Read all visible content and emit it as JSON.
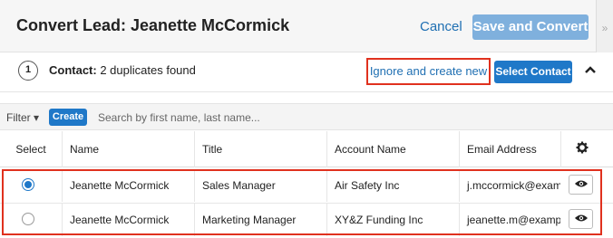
{
  "header": {
    "title": "Convert Lead: Jeanette McCormick",
    "cancel_label": "Cancel",
    "save_label": "Save and Convert",
    "toggle_glyph": "»"
  },
  "step": {
    "number": "1",
    "module": "Contact:",
    "status": "2 duplicates found",
    "ignore_label": "Ignore and create new",
    "select_label": "Select Contact",
    "collapse_icon": "chevron-up-icon"
  },
  "filter": {
    "filter_label": "Filter ▾",
    "create_label": "Create",
    "search_placeholder": "Search by first name, last name..."
  },
  "table": {
    "columns": [
      "Select",
      "Name",
      "Title",
      "Account Name",
      "Email Address"
    ],
    "rows": [
      {
        "selected": true,
        "name": "Jeanette McCormick",
        "title": "Sales Manager",
        "account": "Air Safety Inc",
        "email": "j.mccormick@example.com"
      },
      {
        "selected": false,
        "name": "Jeanette McCormick",
        "title": "Marketing Manager",
        "account": "XY&Z Funding Inc",
        "email": "jeanette.m@example.com"
      }
    ]
  },
  "colors": {
    "accent": "#1f78c8",
    "highlight": "#e0311e"
  }
}
